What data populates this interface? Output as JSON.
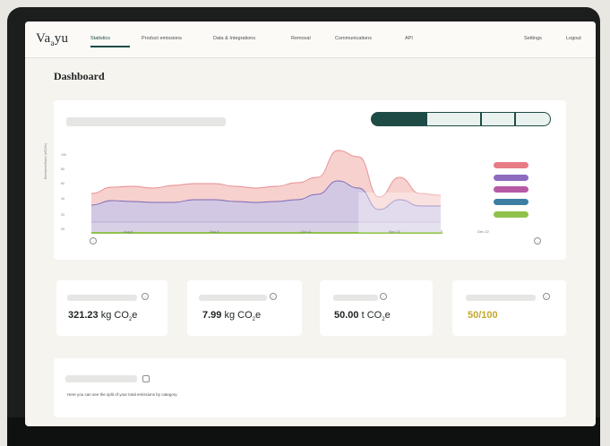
{
  "app": {
    "logo_text": "Vayyu",
    "logo_main": "Va",
    "logo_sub": "a",
    "logo_rest": "yu"
  },
  "nav": {
    "items": [
      {
        "label": "Statistics",
        "active": true
      },
      {
        "label": "Product emissions",
        "active": false
      },
      {
        "label": "Data & Integrations",
        "active": false
      },
      {
        "label": "Removal",
        "active": false
      },
      {
        "label": "Communications",
        "active": false
      },
      {
        "label": "API",
        "active": false
      }
    ],
    "settings_label": "Settings",
    "logout_label": "Logout"
  },
  "page": {
    "title": "Dashboard"
  },
  "chart": {
    "y_axis_label": "Emissions/Sales (kCO2e)",
    "y_ticks": [
      "100",
      "80",
      "60",
      "40",
      "20",
      "00"
    ],
    "x_ticks": [
      "Aug 8",
      "Sep 8",
      "Oct 11",
      "Nov 24",
      "Dec 22"
    ],
    "legend_colors": [
      "#e77c86",
      "#8d6bbe",
      "#b65aa6",
      "#3d7fa3",
      "#8fc24b"
    ],
    "range_buttons": 4
  },
  "chart_data": {
    "type": "area",
    "title": "",
    "xlabel": "",
    "ylabel": "Emissions/Sales (kCO2e)",
    "x_ticks": [
      "Aug 8",
      "Sep 8",
      "Oct 11",
      "Nov 24",
      "Dec 22"
    ],
    "ylim": [
      0,
      100
    ],
    "series": [
      {
        "values": [
          44,
          51,
          52,
          50,
          53,
          55,
          55,
          52,
          50,
          52,
          56,
          62,
          92,
          85,
          40,
          62,
          44,
          42
        ]
      },
      {
        "values": [
          31,
          36,
          35,
          34,
          34,
          37,
          37,
          35,
          34,
          35,
          37,
          43,
          58,
          50,
          26,
          37,
          30,
          30
        ]
      },
      {
        "values": [
          12,
          12,
          12,
          12,
          12,
          12,
          12,
          12,
          12,
          12,
          12,
          12,
          12,
          12,
          12,
          12,
          12,
          12
        ]
      }
    ],
    "legend": "right"
  },
  "stats": [
    {
      "value": "321.23",
      "unit": "kg CO",
      "sub": "2",
      "suffix": "e"
    },
    {
      "value": "7.99",
      "unit": "kg CO",
      "sub": "2",
      "suffix": "e"
    },
    {
      "value": "50.00",
      "unit": "t CO",
      "sub": "2",
      "suffix": "e"
    },
    {
      "value": "50/100",
      "unit": "",
      "sub": "",
      "suffix": ""
    }
  ],
  "category_card": {
    "description": "Here you can see the split of your total emissions by category."
  },
  "colors": {
    "accent": "#1e4b45",
    "score": "#c4a72e",
    "area_outer": "#f4c9c5",
    "area_inner": "#cfc6e6"
  }
}
